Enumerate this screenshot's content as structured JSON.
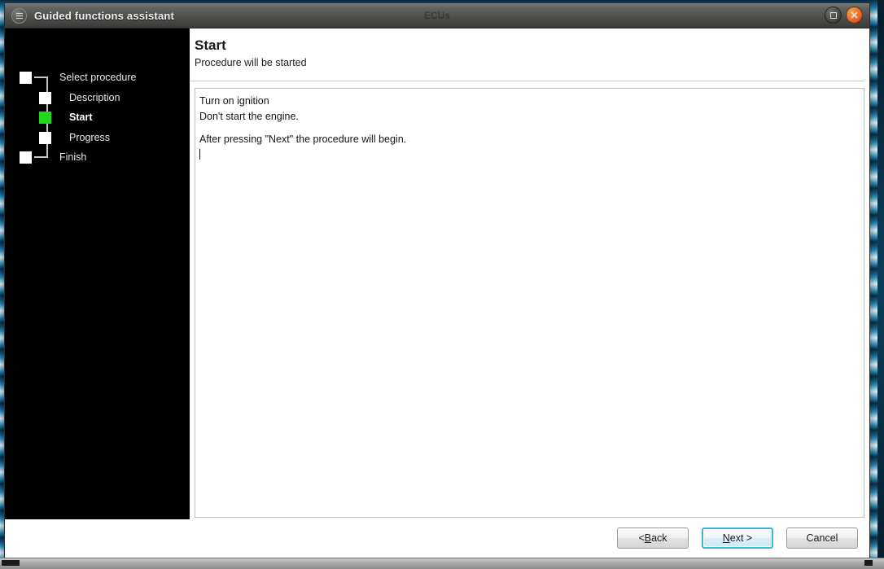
{
  "window": {
    "title": "Guided functions assistant",
    "watermark": "ECUs",
    "menu_icon": "hamburger-circle-icon",
    "controls": {
      "maximize_label": "maximize-icon",
      "close_label": "close-icon"
    }
  },
  "sidebar": {
    "items": [
      {
        "label": "Select procedure",
        "level": "root",
        "active": false
      },
      {
        "label": "Description",
        "level": "child",
        "active": false
      },
      {
        "label": "Start",
        "level": "child",
        "active": true
      },
      {
        "label": "Progress",
        "level": "child",
        "active": false
      },
      {
        "label": "Finish",
        "level": "root",
        "active": false
      }
    ],
    "active_node_color": "#22d81f",
    "node_color": "#ffffff",
    "background": "#000000"
  },
  "content": {
    "title": "Start",
    "subtitle": "Procedure will be started",
    "instructions": {
      "line1": "Turn on ignition",
      "line2": "Don't start the engine.",
      "line3": "After pressing \"Next\" the procedure will begin."
    }
  },
  "footer": {
    "back": {
      "prefix": "< ",
      "accel": "B",
      "suffix": "ack"
    },
    "next": {
      "prefix": "",
      "accel": "N",
      "suffix": "ext >"
    },
    "cancel": {
      "label": "Cancel"
    }
  }
}
